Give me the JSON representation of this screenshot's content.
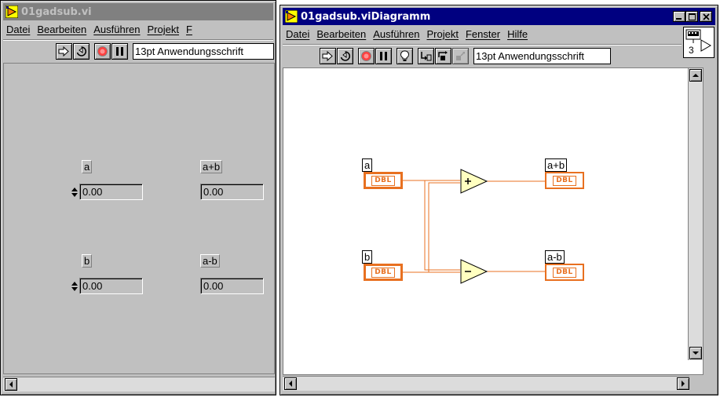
{
  "front_panel": {
    "title": "01gadsub.vi",
    "menu": [
      "Datei",
      "Bearbeiten",
      "Ausführen",
      "Projekt",
      "F"
    ],
    "font_selector": "13pt Anwendungsschrift",
    "controls": [
      {
        "label": "a",
        "value": "0.00",
        "kind": "control"
      },
      {
        "label": "a+b",
        "value": "0.00",
        "kind": "indicator"
      },
      {
        "label": "b",
        "value": "0.00",
        "kind": "control"
      },
      {
        "label": "a-b",
        "value": "0.00",
        "kind": "indicator"
      }
    ]
  },
  "block_diagram": {
    "title": "01gadsub.viDiagramm",
    "menu": [
      "Datei",
      "Bearbeiten",
      "Ausführen",
      "Projekt",
      "Fenster",
      "Hilfe"
    ],
    "font_selector": "13pt Anwendungsschrift",
    "connector_number": "3",
    "terminals": [
      {
        "label": "a",
        "type": "DBL"
      },
      {
        "label": "b",
        "type": "DBL"
      },
      {
        "label": "a+b",
        "type": "DBL"
      },
      {
        "label": "a-b",
        "type": "DBL"
      }
    ],
    "operators": {
      "add": "+",
      "subtract": "-"
    },
    "wire_color": "#e87020"
  },
  "colors": {
    "active_title": "#000080",
    "inactive_title": "#808080",
    "window_face": "#c0c0c0",
    "terminal_orange": "#e87020",
    "operator_fill": "#ffffc0"
  }
}
